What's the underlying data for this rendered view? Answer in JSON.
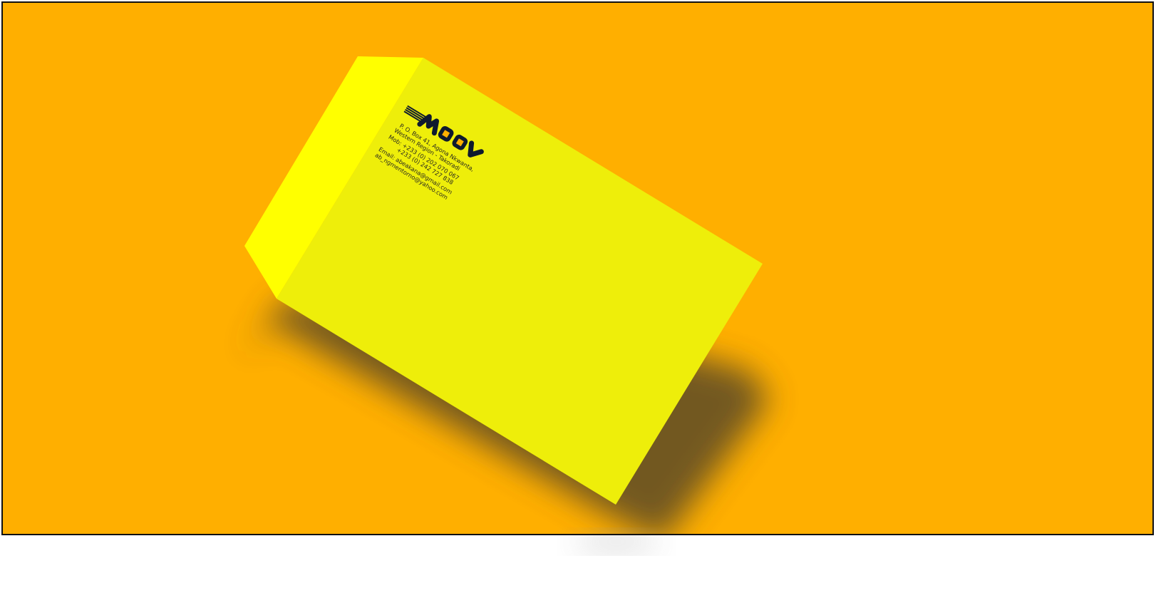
{
  "scene": {
    "background_color": "#FFAF00",
    "envelope_face_color": "#EEEE0A",
    "envelope_flap_color": "#FFFF00",
    "shadow_color": "#5A4A28"
  },
  "brand": {
    "logo_text": "MOOV",
    "logo_color": "#0F1A2E",
    "logo_accent_color": "#FFAF00"
  },
  "address": {
    "line1": "P. O. Box 41, Agona Nkwanta,",
    "line2": "Western Region - Takoradi",
    "mob_label_line": "Mob: +233 (0) 202 070 067",
    "mob_line2": "+233 (0) 242 727 838",
    "email_line1": "Email: abeakana@gmail.com",
    "email_line2": "ab_ngmentorno@yahoo.com"
  }
}
